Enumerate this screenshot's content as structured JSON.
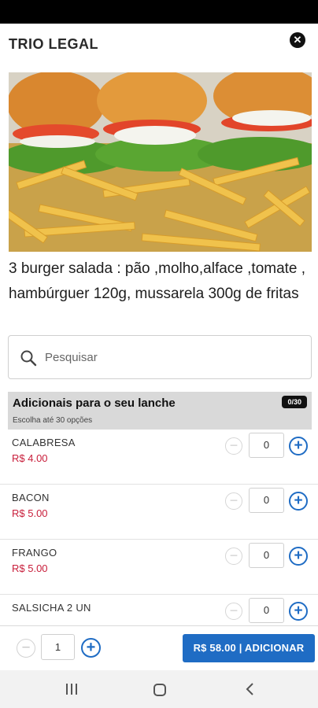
{
  "header": {
    "title": "TRIO LEGAL",
    "close_icon": "close-circle-icon"
  },
  "product": {
    "image": "burgers-and-fries-photo",
    "description": "3 burger salada : pão ,molho,alface ,tomate , hambúrguer 120g, mussarela 300g de fritas"
  },
  "search": {
    "placeholder": "Pesquisar",
    "icon": "search-icon"
  },
  "addons": {
    "title": "Adicionais para o seu lanche",
    "subtitle": "Escolha até 30 opções",
    "badge": "0/30",
    "items": [
      {
        "name": "CALABRESA",
        "price": "R$ 4.00",
        "qty": "0"
      },
      {
        "name": "BACON",
        "price": "R$ 5.00",
        "qty": "0"
      },
      {
        "name": "FRANGO",
        "price": "R$ 5.00",
        "qty": "0"
      },
      {
        "name": "SALSICHA 2 UN",
        "price": "",
        "qty": "0"
      }
    ]
  },
  "footer": {
    "quantity": "1",
    "add_button": "R$ 58.00 | ADICIONAR"
  },
  "colors": {
    "accent": "#1f6cc4",
    "price": "#c81d3a"
  }
}
